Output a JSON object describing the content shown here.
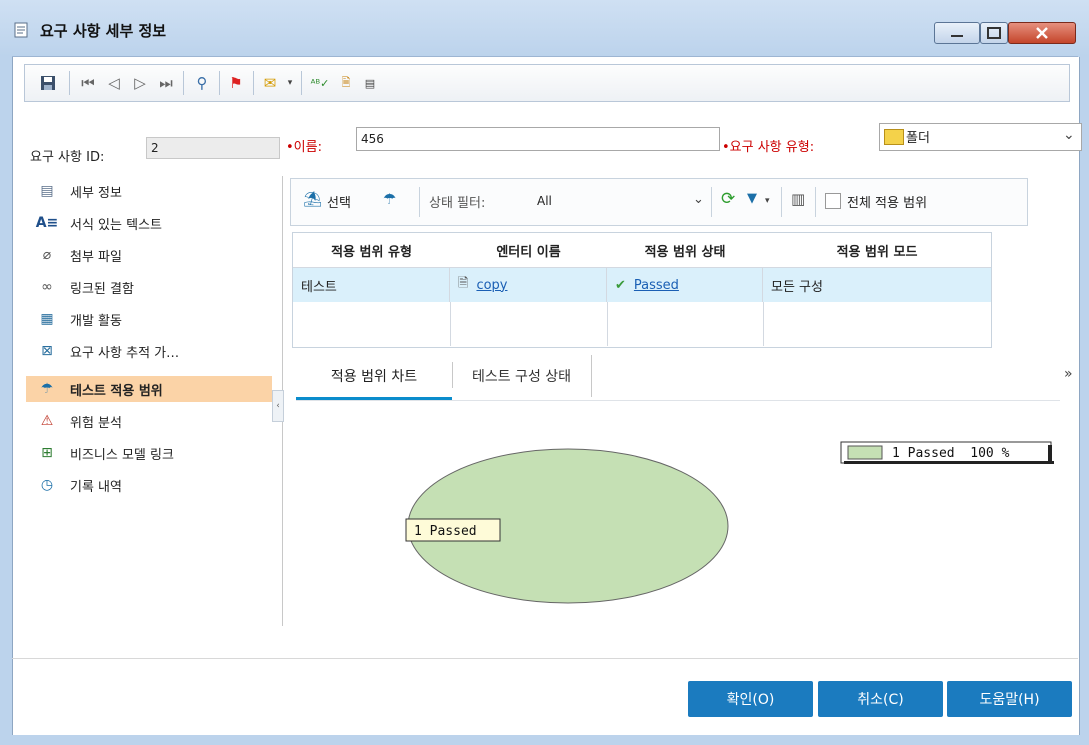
{
  "window": {
    "title": "요구 사항 세부 정보"
  },
  "form": {
    "id_label": "요구 사항 ID:",
    "id_value": "2",
    "name_label": "•이름:",
    "name_value": "456",
    "type_label": "•요구 사항 유형:",
    "type_value": "폴더"
  },
  "sidebar": {
    "items": [
      {
        "label": "세부 정보",
        "icon": "details-icon"
      },
      {
        "label": "서식 있는 텍스트",
        "icon": "rich-text-icon"
      },
      {
        "label": "첨부 파일",
        "icon": "attachment-icon"
      },
      {
        "label": "링크된 결함",
        "icon": "linked-defects-icon"
      },
      {
        "label": "개발 활동",
        "icon": "dev-activity-icon"
      },
      {
        "label": "요구 사항 추적 가…",
        "icon": "traceability-icon"
      },
      {
        "label": "테스트 적용 범위",
        "icon": "umbrella-icon"
      },
      {
        "label": "위험 분석",
        "icon": "risk-icon"
      },
      {
        "label": "비즈니스 모델 링크",
        "icon": "business-model-icon"
      },
      {
        "label": "기록 내역",
        "icon": "history-icon"
      }
    ]
  },
  "coverage_toolbar": {
    "select_label": "선택",
    "status_filter_label": "상태 필터:",
    "status_filter_value": "All",
    "entire_scope_label": "전체 적용 범위"
  },
  "grid": {
    "columns": [
      "적용 범위 유형",
      "엔터티 이름",
      "적용 범위 상태",
      "적용 범위 모드"
    ],
    "rows": [
      {
        "type": "테스트",
        "entity": "copy",
        "status": "Passed",
        "mode": "모든 구성"
      }
    ]
  },
  "tabs": [
    {
      "label": "적용 범위 차트"
    },
    {
      "label": "테스트 구성 상태"
    }
  ],
  "chart_data": {
    "type": "pie",
    "categories": [
      "Passed"
    ],
    "values": [
      1
    ],
    "slice_label": "1 Passed",
    "legend": [
      "1 Passed  100 %"
    ],
    "legend_position": "top-right",
    "colors": [
      "#c5e0b4"
    ]
  },
  "buttons": {
    "ok": "확인(O)",
    "cancel": "취소(C)",
    "help": "도움말(H)"
  }
}
